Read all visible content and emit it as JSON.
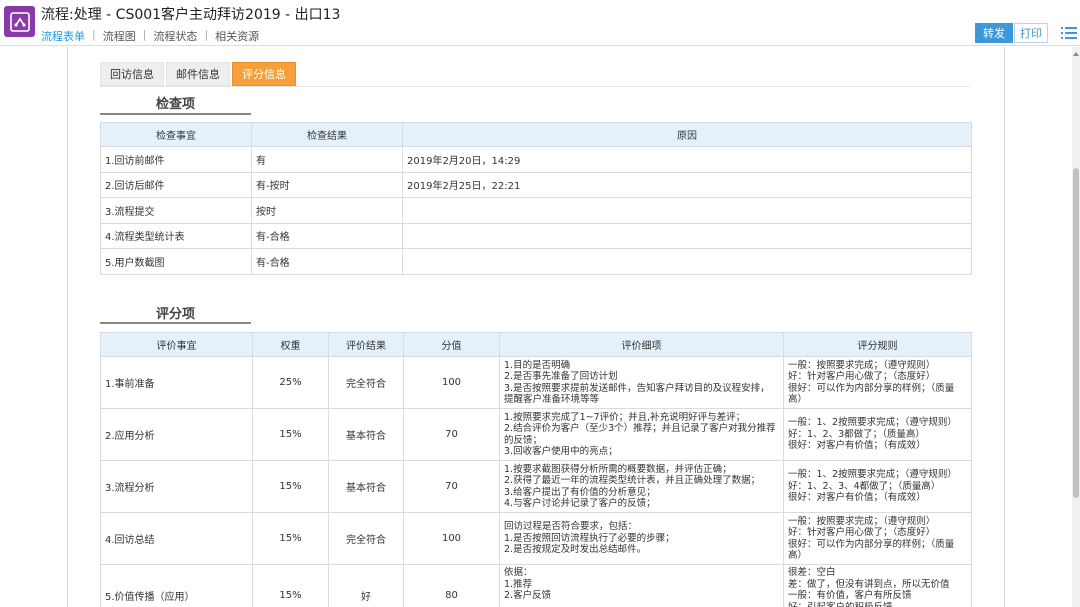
{
  "header": {
    "title": "流程:处理 - CS001客户主动拜访2019 - 出口13",
    "nav": [
      "流程表单",
      "流程图",
      "流程状态",
      "相关资源"
    ],
    "forward_label": "转发",
    "print_label": "打印"
  },
  "tabs": [
    "回访信息",
    "邮件信息",
    "评分信息"
  ],
  "active_tab": "评分信息",
  "check_section": {
    "title": "检查项",
    "columns": [
      "检查事宜",
      "检查结果",
      "原因"
    ],
    "rows": [
      [
        "1.回访前邮件",
        "有",
        "2019年2月20日，14:29"
      ],
      [
        "2.回访后邮件",
        "有-按时",
        "2019年2月25日，22:21"
      ],
      [
        "3.流程提交",
        "按时",
        ""
      ],
      [
        "4.流程类型统计表",
        "有-合格",
        ""
      ],
      [
        "5.用户数截图",
        "有-合格",
        ""
      ]
    ]
  },
  "score_section": {
    "title": "评分项",
    "columns": [
      "评价事宜",
      "权重",
      "评价结果",
      "分值",
      "评价细项",
      "评分规则"
    ],
    "rows": [
      [
        "1.事前准备",
        "25%",
        "完全符合",
        "100",
        "1.目的是否明确\n2.是否事先准备了回访计划\n3.是否按照要求提前发送邮件，告知客户拜访目的及议程安排，提醒客户准备环境等等",
        "一般：按照要求完成；（遵守规则）\n好：针对客户用心做了；（态度好）\n很好：可以作为内部分享的样例；（质量高）"
      ],
      [
        "2.应用分析",
        "15%",
        "基本符合",
        "70",
        "1.按照要求完成了1~7评价；并且,补充说明好评与差评；\n2.结合评价为客户（至少3个）推荐；并且记录了客户对我分推荐的反馈；\n3.回收客户使用中的亮点；",
        "一般：1、2按照要求完成；（遵守规则）\n好：1、2、3都做了；（质量高）\n很好：对客户有价值；（有成效）"
      ],
      [
        "3.流程分析",
        "15%",
        "基本符合",
        "70",
        "1.按要求截图获得分析所需的概要数据，并评估正确；\n2.获得了最近一年的流程类型统计表，并且正确处理了数据；\n3.给客户提出了有价值的分析意见；\n4.与客户讨论并记录了客户的反馈；",
        "一般：1、2按照要求完成；（遵守规则）\n好：1、2、3、4都做了；（质量高）\n很好：对客户有价值；（有成效）"
      ],
      [
        "4.回访总结",
        "15%",
        "完全符合",
        "100",
        "回访过程是否符合要求，包括：\n1.是否按照回访流程执行了必要的步骤；\n2.是否按规定及时发出总结邮件。",
        "一般：按照要求完成；（遵守规则）\n好：针对客户用心做了；（态度好）\n很好：可以作为内部分享的样例；（质量高）"
      ],
      [
        "5.价值传播（应用）",
        "15%",
        "好",
        "80",
        "依据：\n1.推荐\n2.客户反馈",
        "很差：空白\n差：做了，但没有讲到点，所以无价值\n一般：有价值，客户有所反馈\n好：引起客户的积极反馈"
      ]
    ]
  }
}
